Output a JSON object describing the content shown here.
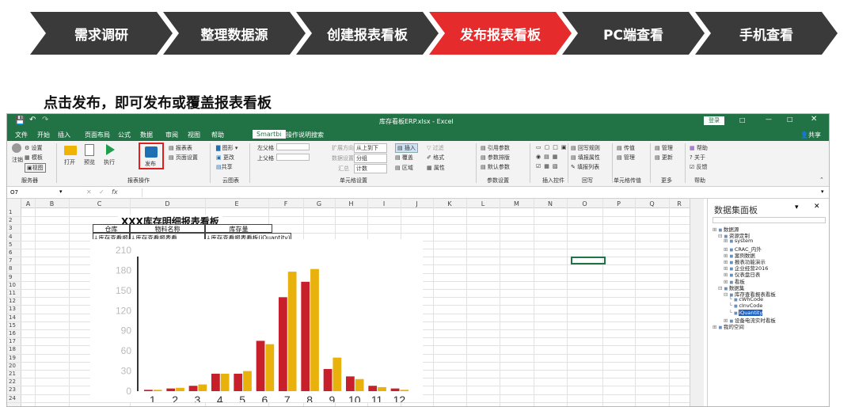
{
  "steps": [
    "需求调研",
    "整理数据源",
    "创建报表看板",
    "发布报表看板",
    "PC端查看",
    "手机查看"
  ],
  "active_step": 3,
  "headline": "点击发布，即可发布或覆盖报表看板",
  "excel": {
    "window_title": "库存看板ERP.xlsx - Excel",
    "signin": "登录",
    "share": "共享",
    "tabs": [
      "文件",
      "开始",
      "插入",
      "页面布局",
      "公式",
      "数据",
      "审阅",
      "视图",
      "帮助",
      "Smartbi",
      "操作说明搜索"
    ],
    "active_tab": "Smartbi",
    "ribbon": {
      "server": {
        "settings": "设置",
        "template": "模板",
        "logout": "注销",
        "view": "视图",
        "group": "服务器"
      },
      "report_ops": {
        "open": "打开",
        "preview": "预览",
        "execute": "执行",
        "publish": "发布",
        "report_list": "报表表",
        "page_settings": "页面设置",
        "group": "报表操作"
      },
      "cloud_chart": {
        "chart": "图形",
        "change": "更改",
        "share": "共享",
        "group": "云图表"
      },
      "cell_settings": {
        "left_parent": "左父格",
        "up_parent": "上父格",
        "expand_dir": "扩展方向",
        "expand_val": "从上到下",
        "data_settings": "数据设置",
        "data_val": "分组",
        "summary": "汇总",
        "summary_val": "计数",
        "insert": "插入",
        "cover": "覆盖",
        "area": "区域",
        "filter": "过滤",
        "format": "格式",
        "property": "属性",
        "group": "单元格设置"
      },
      "param_settings": {
        "ref_param": "引用参数",
        "param_layout": "参数排版",
        "default_param": "默认参数",
        "group": "参数设置"
      },
      "insert_ctrl": {
        "group": "插入控件"
      },
      "writeback": {
        "rule": "回写规则",
        "fill_prop": "填报属性",
        "fill_list": "填报列表",
        "group": "回写"
      },
      "cell_transfer": {
        "transfer": "传值",
        "manage": "管理",
        "group": "单元格传值"
      },
      "more": {
        "manage": "管理",
        "update": "更新",
        "group": "更多"
      },
      "help": {
        "help": "帮助",
        "about": "关于",
        "feedback": "反馈",
        "group": "帮助"
      }
    },
    "name_box": "O7",
    "fx": "fx",
    "columns": [
      "A",
      "B",
      "C",
      "D",
      "E",
      "F",
      "G",
      "H",
      "I",
      "J",
      "K",
      "L",
      "M",
      "N",
      "O",
      "P",
      "Q",
      "R"
    ],
    "rows": [
      "1",
      "2",
      "3",
      "4",
      "5",
      "6",
      "7",
      "8",
      "9",
      "10",
      "11",
      "12",
      "13",
      "14",
      "15",
      "16",
      "17",
      "18",
      "19",
      "20",
      "21",
      "22",
      "23",
      "24"
    ],
    "sheet": {
      "title": "XXX库存明细报表看板",
      "headers": [
        "仓库",
        "物料名称",
        "库存量"
      ],
      "row4": [
        "↓库存查看报表",
        "↓库存查看报表看",
        "↓库存查看报表看板(iQuantity)"
      ]
    },
    "panel": {
      "title": "数据集面板",
      "tree": [
        "数据源",
        "资源定制",
        "system",
        "CRAC_内外",
        "案例数据",
        "报表功能演示",
        "企业经营2016",
        "仪表盘日表",
        "看板",
        "数据集",
        "库存查看报表看板",
        "cWhCode",
        "cInvCode",
        "iQuantity",
        "设备电流实时看板",
        "我的空间"
      ]
    }
  },
  "chart_data": {
    "type": "bar",
    "categories": [
      "1",
      "2",
      "3",
      "4",
      "5",
      "6",
      "7",
      "8",
      "9",
      "10",
      "11",
      "12"
    ],
    "ylim": [
      0,
      210
    ],
    "yticks": [
      "210",
      "180",
      "150",
      "120",
      "90",
      "60",
      "30",
      "0"
    ],
    "series": [
      {
        "color": "#c8202a",
        "values": [
          2,
          4,
          8,
          26,
          26,
          75,
          140,
          163,
          33,
          22,
          8,
          4
        ]
      },
      {
        "color": "#e8b10c",
        "values": [
          2,
          5,
          10,
          26,
          30,
          70,
          178,
          182,
          50,
          18,
          6,
          2
        ]
      }
    ]
  }
}
